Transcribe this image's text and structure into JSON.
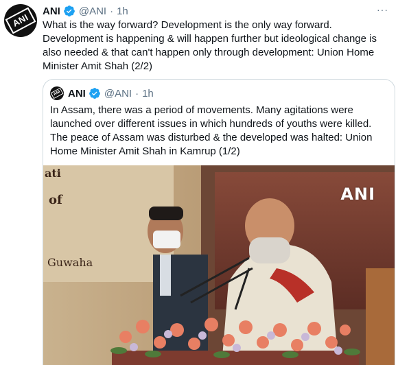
{
  "tweet": {
    "name": "ANI",
    "handle": "@ANI",
    "dot": "·",
    "time": "1h",
    "more": "···",
    "text": "What is the way forward? Development is the only way forward. Development is happening & will happen further but ideological change is also needed & that can't happen only through development: Union Home Minister Amit Shah (2/2)"
  },
  "quoted_tweet": {
    "name": "ANI",
    "handle": "@ANI",
    "dot": "·",
    "time": "1h",
    "text": "In Assam, there was a period of movements. Many agitations were launched over different issues in which hundreds of youths were killed. The peace of Assam was disturbed & the developed was halted: Union Home Minister Amit Shah in Kamrup (1/2)"
  },
  "media": {
    "watermark": "ANI",
    "backdrop_text_1": "ati",
    "backdrop_text_2": "of",
    "backdrop_text_3": "Guwaha"
  },
  "colors": {
    "verified": "#1da1f2",
    "secondary_text": "#5b7083",
    "border": "#cfd9de"
  },
  "icons": [
    "verified-badge-icon",
    "more-options-icon"
  ]
}
